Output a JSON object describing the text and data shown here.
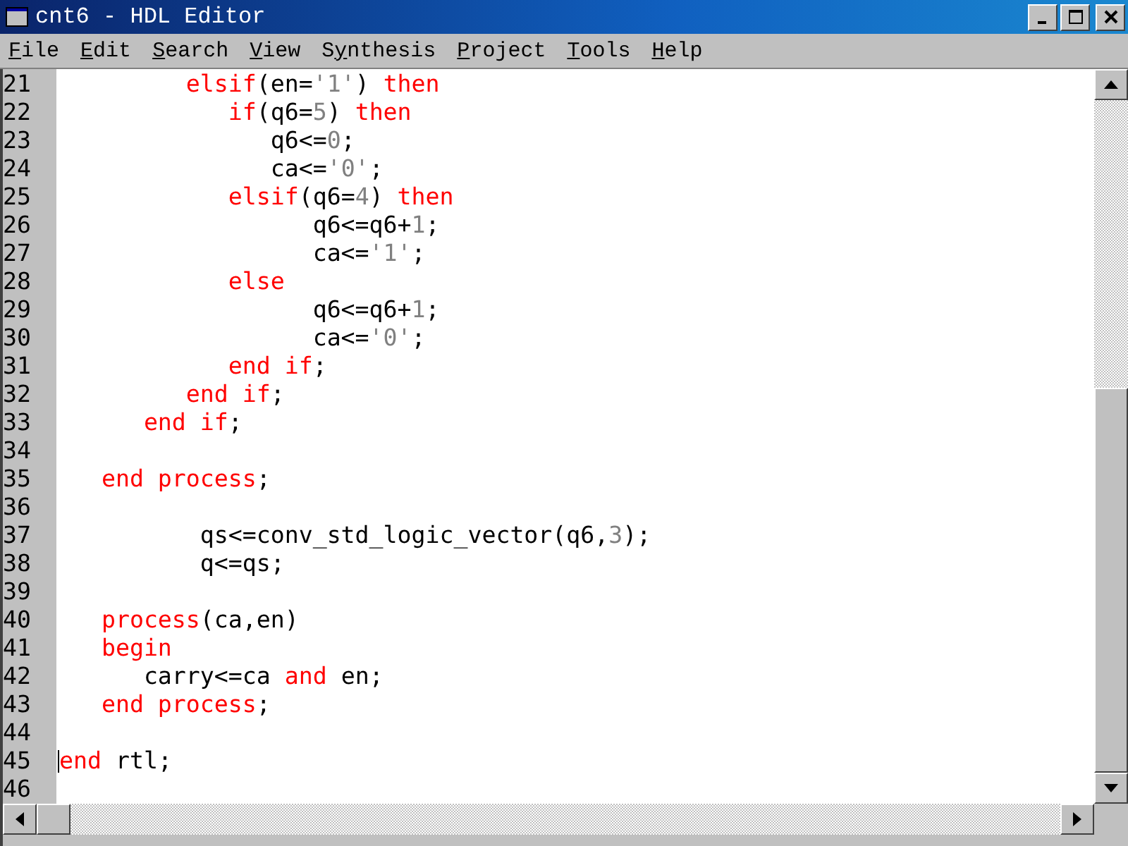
{
  "window": {
    "title": "cnt6 - HDL Editor"
  },
  "menu": [
    {
      "key": "F",
      "post": "ile"
    },
    {
      "key": "E",
      "post": "dit"
    },
    {
      "key": "S",
      "post": "earch"
    },
    {
      "key": "V",
      "post": "iew"
    },
    {
      "pre": "S",
      "key": "y",
      "post": "nthesis"
    },
    {
      "key": "P",
      "post": "roject"
    },
    {
      "key": "T",
      "post": "ools"
    },
    {
      "key": "H",
      "post": "elp"
    }
  ],
  "lines": [
    {
      "number": "21",
      "tokens": [
        {
          "kind": "kw",
          "text": "         elsif"
        },
        {
          "kind": "id",
          "text": "(en="
        },
        {
          "kind": "num",
          "text": "'1'"
        },
        {
          "kind": "id",
          "text": ") "
        },
        {
          "kind": "kw",
          "text": "then"
        }
      ]
    },
    {
      "number": "22",
      "tokens": [
        {
          "kind": "kw",
          "text": "            if"
        },
        {
          "kind": "id",
          "text": "(q6="
        },
        {
          "kind": "num",
          "text": "5"
        },
        {
          "kind": "id",
          "text": ") "
        },
        {
          "kind": "kw",
          "text": "then"
        }
      ]
    },
    {
      "number": "23",
      "tokens": [
        {
          "kind": "id",
          "text": "               q6<="
        },
        {
          "kind": "num",
          "text": "0"
        },
        {
          "kind": "id",
          "text": ";"
        }
      ]
    },
    {
      "number": "24",
      "tokens": [
        {
          "kind": "id",
          "text": "               ca<="
        },
        {
          "kind": "num",
          "text": "'0'"
        },
        {
          "kind": "id",
          "text": ";"
        }
      ]
    },
    {
      "number": "25",
      "tokens": [
        {
          "kind": "kw",
          "text": "            elsif"
        },
        {
          "kind": "id",
          "text": "(q6="
        },
        {
          "kind": "num",
          "text": "4"
        },
        {
          "kind": "id",
          "text": ") "
        },
        {
          "kind": "kw",
          "text": "then"
        }
      ]
    },
    {
      "number": "26",
      "tokens": [
        {
          "kind": "id",
          "text": "                  q6<=q6+"
        },
        {
          "kind": "num",
          "text": "1"
        },
        {
          "kind": "id",
          "text": ";"
        }
      ]
    },
    {
      "number": "27",
      "tokens": [
        {
          "kind": "id",
          "text": "                  ca<="
        },
        {
          "kind": "num",
          "text": "'1'"
        },
        {
          "kind": "id",
          "text": ";"
        }
      ]
    },
    {
      "number": "28",
      "tokens": [
        {
          "kind": "kw",
          "text": "            else"
        }
      ]
    },
    {
      "number": "29",
      "tokens": [
        {
          "kind": "id",
          "text": "                  q6<=q6+"
        },
        {
          "kind": "num",
          "text": "1"
        },
        {
          "kind": "id",
          "text": ";"
        }
      ]
    },
    {
      "number": "30",
      "tokens": [
        {
          "kind": "id",
          "text": "                  ca<="
        },
        {
          "kind": "num",
          "text": "'0'"
        },
        {
          "kind": "id",
          "text": ";"
        }
      ]
    },
    {
      "number": "31",
      "tokens": [
        {
          "kind": "kw",
          "text": "            end if"
        },
        {
          "kind": "id",
          "text": ";"
        }
      ]
    },
    {
      "number": "32",
      "tokens": [
        {
          "kind": "kw",
          "text": "         end if"
        },
        {
          "kind": "id",
          "text": ";"
        }
      ]
    },
    {
      "number": "33",
      "tokens": [
        {
          "kind": "kw",
          "text": "      end if"
        },
        {
          "kind": "id",
          "text": ";"
        }
      ]
    },
    {
      "number": "34"
    },
    {
      "number": "35",
      "tokens": [
        {
          "kind": "kw",
          "text": "   end process"
        },
        {
          "kind": "id",
          "text": ";"
        }
      ]
    },
    {
      "number": "36"
    },
    {
      "number": "37",
      "tokens": [
        {
          "kind": "id",
          "text": "          qs<=conv_std_logic_vector(q6,"
        },
        {
          "kind": "num",
          "text": "3"
        },
        {
          "kind": "id",
          "text": ");"
        }
      ]
    },
    {
      "number": "38",
      "tokens": [
        {
          "kind": "id",
          "text": "          q<=qs;"
        }
      ]
    },
    {
      "number": "39"
    },
    {
      "number": "40",
      "tokens": [
        {
          "kind": "kw",
          "text": "   process"
        },
        {
          "kind": "id",
          "text": "(ca,en)"
        }
      ]
    },
    {
      "number": "41",
      "tokens": [
        {
          "kind": "kw",
          "text": "   begin"
        }
      ]
    },
    {
      "number": "42",
      "tokens": [
        {
          "kind": "id",
          "text": "      carry<=ca "
        },
        {
          "kind": "kw",
          "text": "and"
        },
        {
          "kind": "id",
          "text": " en;"
        }
      ]
    },
    {
      "number": "43",
      "tokens": [
        {
          "kind": "kw",
          "text": "   end process"
        },
        {
          "kind": "id",
          "text": ";"
        }
      ]
    },
    {
      "number": "44"
    },
    {
      "number": "45",
      "cursor": true,
      "tokens": [
        {
          "kind": "kw",
          "text": "end"
        },
        {
          "kind": "id",
          "text": " rtl;"
        }
      ]
    },
    {
      "number": "46"
    }
  ]
}
